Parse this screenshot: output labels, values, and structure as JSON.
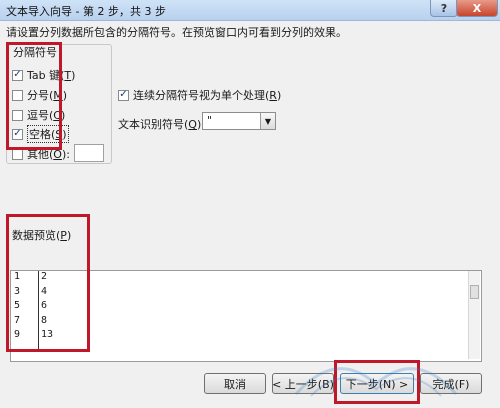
{
  "window": {
    "title": "文本导入向导 - 第 2 步，共 3 步",
    "help_glyph": "?",
    "close_glyph": "X"
  },
  "instruction": "请设置分列数据所包含的分隔符号。在预览窗口内可看到分列的效果。",
  "delimiters": {
    "legend": "分隔符号",
    "items": [
      {
        "label": "Tab 键",
        "key": "T",
        "checked": true,
        "mark": "✓"
      },
      {
        "label": "分号",
        "key": "M",
        "checked": false,
        "mark": ""
      },
      {
        "label": "逗号",
        "key": "C",
        "checked": false,
        "mark": ""
      },
      {
        "label": "空格",
        "key": "S",
        "checked": true,
        "mark": "✓"
      },
      {
        "label": "其他",
        "key": "O",
        "checked": false,
        "mark": ""
      }
    ]
  },
  "consecutive": {
    "label": "连续分隔符号视为单个处理",
    "key": "R",
    "checked": true,
    "mark": "✓"
  },
  "text_qualifier": {
    "label": "文本识别符号",
    "key": "Q",
    "value": "\""
  },
  "preview": {
    "label": "数据预览",
    "key": "P",
    "rows": [
      [
        "1",
        "2"
      ],
      [
        "3",
        "4"
      ],
      [
        "5",
        "6"
      ],
      [
        "7",
        "8"
      ],
      [
        "9",
        "13"
      ]
    ]
  },
  "buttons": {
    "cancel": "取消",
    "back": "< 上一步(B)",
    "next": "下一步(N) >",
    "finish": "完成(F)"
  }
}
